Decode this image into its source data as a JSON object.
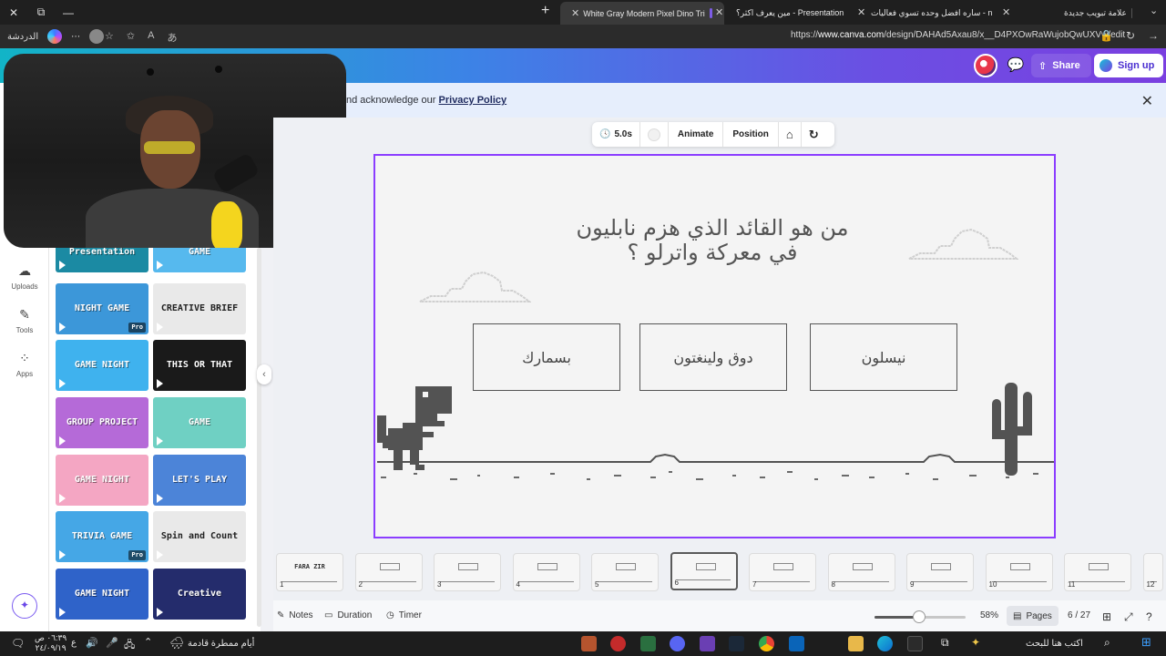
{
  "browser": {
    "tabs": [
      {
        "title": "علامة تبويب جديدة"
      },
      {
        "title": "ساره افضل وحده تسوي فعاليات - n"
      },
      {
        "title": "مين يعرف اكثر؟ - Presentation"
      },
      {
        "title": "White Gray Modern Pixel Dino Tri"
      }
    ],
    "url_prefix": "https://",
    "url_domain": "www.canva.com",
    "url_path": "/design/DAHAd5Axau8/x__D4PXOwRaWujobQwUXVw/edit",
    "profile_label": "الدردشة"
  },
  "header": {
    "share_label": "Share",
    "signup_label": "Sign up"
  },
  "banner": {
    "text": "nd acknowledge our ",
    "link": "Privacy Policy"
  },
  "rail": {
    "uploads": "Uploads",
    "tools": "Tools",
    "apps": "Apps"
  },
  "templates": [
    {
      "label": "Presentation",
      "bg": "#1b8aa3"
    },
    {
      "label": "GAME",
      "bg": "#56b9ee"
    },
    {
      "label": "NIGHT GAME",
      "bg": "#3c97d9",
      "pro": "Pro"
    },
    {
      "label": "CREATIVE BRIEF",
      "bg": "#e9e9e9"
    },
    {
      "label": "GAME NIGHT",
      "bg": "#3fb2ee"
    },
    {
      "label": "THIS OR THAT",
      "bg": "#1a1a1a"
    },
    {
      "label": "GROUP PROJECT",
      "bg": "#b56ad8"
    },
    {
      "label": "GAME",
      "bg": "#6fd0c3"
    },
    {
      "label": "GAME NIGHT",
      "bg": "#f4a6c3"
    },
    {
      "label": "LET'S PLAY",
      "bg": "#4c84d8"
    },
    {
      "label": "TRIVIA GAME",
      "bg": "#45a7e6",
      "pro": "Pro"
    },
    {
      "label": "Spin and Count",
      "bg": "#e9e9e9"
    },
    {
      "label": "GAME NIGHT",
      "bg": "#2f63c9"
    },
    {
      "label": "Creative Portfolio",
      "bg": "#242c6c"
    }
  ],
  "toolbar": {
    "duration": "5.0s",
    "animate": "Animate",
    "position": "Position"
  },
  "slide": {
    "question_line1": "من هو القائد الذي هزم نابليون",
    "question_line2": "في معركة واترلو ؟",
    "answers": [
      "بسمارك",
      "دوق ولينغتون",
      "نيسلون"
    ]
  },
  "pages": {
    "labels": [
      "1",
      "2",
      "3",
      "4",
      "5",
      "6",
      "7",
      "8",
      "9",
      "10",
      "11",
      "12"
    ],
    "selected": "6",
    "thumb1_title": "FARA ZIR"
  },
  "bottom": {
    "notes": "Notes",
    "duration": "Duration",
    "timer": "Timer",
    "zoom": "58%",
    "pages_btn": "Pages",
    "page_count": "6 / 27"
  },
  "taskbar": {
    "search_placeholder": "اكتب هنا للبحث",
    "weather": "أيام ممطرة قادمة",
    "time": "٠٦:٣٩ ص",
    "date": "٢٤/٠٩/١٩",
    "lang": "ع"
  },
  "colors": {
    "accent": "#8b3dff",
    "slide_text": "#555555"
  }
}
